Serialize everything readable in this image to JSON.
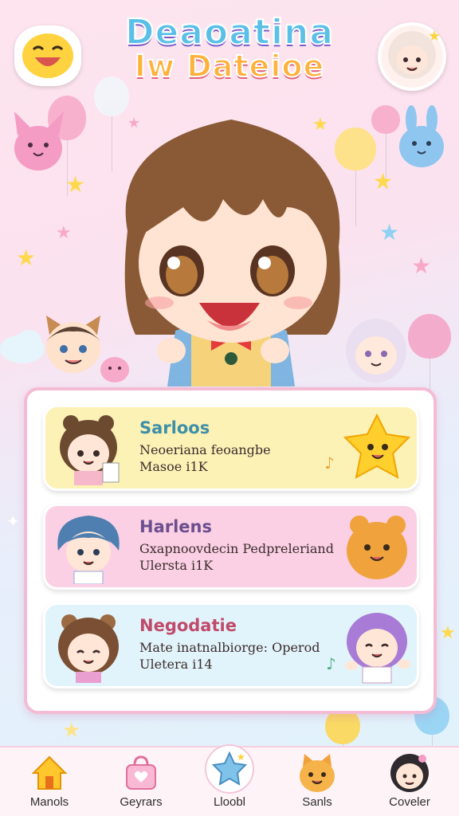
{
  "header": {
    "title_line1": "Deaoatina",
    "title_line2": "Iw Dateioe"
  },
  "icons": {
    "top_left": "smiley-face-icon",
    "top_right": "girl-avatar-icon",
    "hero": "chibi-girl-illustration"
  },
  "list": {
    "items": [
      {
        "name": "Sarloos",
        "description": "Neoeriana feoangbe",
        "meta": "Masoe i1K",
        "name_color": "#3e8fa8",
        "bg": "#fcf2b6",
        "avatar": "brown-hair-girl-avatar",
        "pet": "yellow-star-pet-icon",
        "note_icon": "music-note-icon"
      },
      {
        "name": "Harlens",
        "description": "Gxapnoovdecin Pedpreleriand",
        "meta": "Ulersta i1K",
        "name_color": "#6c4f8f",
        "bg": "#fbd0e4",
        "avatar": "blue-hair-boy-avatar",
        "pet": "orange-bear-pet-icon",
        "note_icon": ""
      },
      {
        "name": "Negodatie",
        "description": "Mate inatnalbiorge: Operod",
        "meta": "Uletera i14",
        "name_color": "#c04a6a",
        "bg": "#e2f4fb",
        "avatar": "bear-ear-girl-avatar",
        "pet": "purple-hair-girl-icon",
        "note_icon": "music-note-icon"
      }
    ]
  },
  "nav": {
    "items": [
      {
        "label": "Manols",
        "icon": "home-icon"
      },
      {
        "label": "Geyrars",
        "icon": "shopping-bag-icon"
      },
      {
        "label": "Lloobl",
        "icon": "star-pet-icon"
      },
      {
        "label": "Sanls",
        "icon": "cat-icon"
      },
      {
        "label": "Coveler",
        "icon": "profile-avatar-icon"
      }
    ]
  },
  "colors": {
    "accent_pink": "#f4bcd4",
    "title_blue": "#5bc0e8",
    "title_orange": "#ffb13b"
  }
}
